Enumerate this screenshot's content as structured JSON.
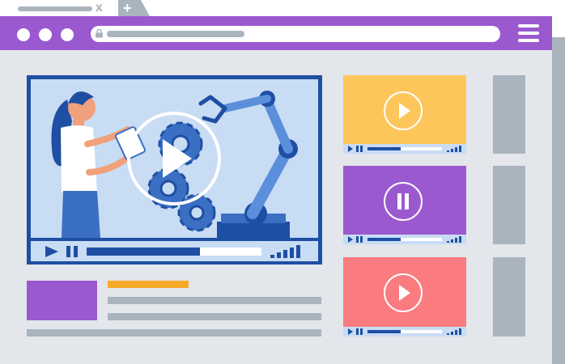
{
  "browser": {
    "tab": {
      "close_symbol": "x"
    },
    "new_tab_symbol": "+",
    "menu_icon": "hamburger-icon",
    "window_dots": 3
  },
  "colors": {
    "topbar": "#9b59d0",
    "player_border": "#1e4fa3",
    "scene_bg": "#c8dcf4",
    "thumb_yellow": "#fdc65a",
    "thumb_purple": "#9b59d0",
    "thumb_red": "#fa7b80",
    "accent_orange": "#f7a928",
    "placeholder_gray": "#aab4bf"
  },
  "main_player": {
    "overlay_icon": "play-icon",
    "controls": [
      "play-icon",
      "pause-icon"
    ],
    "progress": 0.65,
    "volume_icon": "signal-bars-icon"
  },
  "playlist": [
    {
      "color": "#fdc65a",
      "state_icon": "play-icon",
      "progress": 0.45
    },
    {
      "color": "#9b59d0",
      "state_icon": "pause-icon",
      "progress": 0.45
    },
    {
      "color": "#fa7b80",
      "state_icon": "play-icon",
      "progress": 0.45
    }
  ]
}
